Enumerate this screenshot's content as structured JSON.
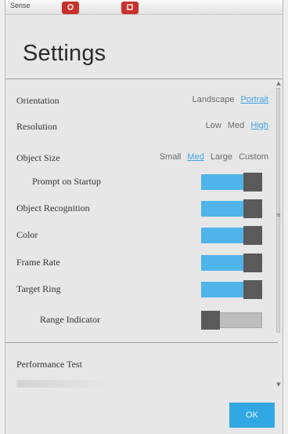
{
  "window": {
    "app_title": "Sense"
  },
  "header": {
    "title": "Settings"
  },
  "settings": {
    "orientation": {
      "label": "Orientation",
      "options": [
        "Landscape",
        "Portrait"
      ],
      "selected": "Portrait"
    },
    "resolution": {
      "label": "Resolution",
      "options": [
        "Low",
        "Med",
        "High"
      ],
      "selected": "High"
    },
    "object_size": {
      "label": "Object Size",
      "options": [
        "Small",
        "Med",
        "Large",
        "Custom"
      ],
      "selected": "Med"
    },
    "toggles": [
      {
        "label": "Prompt on Startup",
        "on": true,
        "indented": true
      },
      {
        "label": "Object Recognition",
        "on": true,
        "indented": false
      },
      {
        "label": "Color",
        "on": true,
        "indented": false
      },
      {
        "label": "Frame Rate",
        "on": true,
        "indented": false
      },
      {
        "label": "Target Ring",
        "on": true,
        "indented": false
      },
      {
        "label": "Range Indicator",
        "on": false,
        "indented": true
      }
    ]
  },
  "performance": {
    "label": "Performance Test"
  },
  "footer": {
    "ok_label": "OK"
  },
  "colors": {
    "accent": "#31a8e4",
    "toggle_fill": "#4fb4ea",
    "toggle_thumb": "#5a5a5a",
    "background": "#e7e7e7"
  },
  "icons": {
    "scroll_up": "scroll-up-arrow",
    "scroll_down": "scroll-down-arrow"
  }
}
